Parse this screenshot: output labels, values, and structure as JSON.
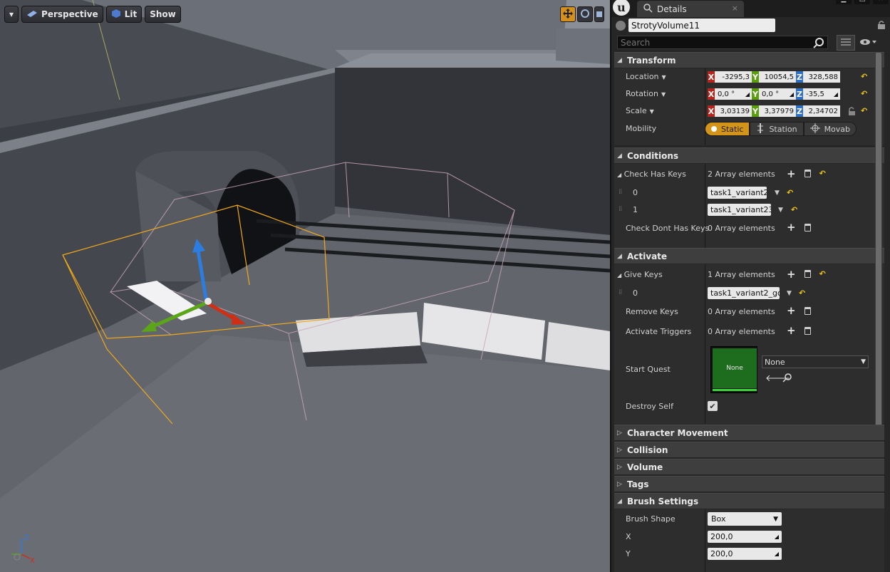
{
  "viewport": {
    "toolbar": {
      "menu_arrow": "▾",
      "perspective_label": "Perspective",
      "lit_label": "Lit",
      "show_label": "Show"
    },
    "axis_labels": {
      "z": "Z",
      "x": "X"
    }
  },
  "details": {
    "tab_label": "Details",
    "tab_close": "×",
    "object_name": "StrotyVolume11",
    "search_placeholder": "Search",
    "transform": {
      "header": "Transform",
      "location_label": "Location",
      "rotation_label": "Rotation",
      "scale_label": "Scale",
      "mobility_label": "Mobility",
      "location": {
        "x": "-3295,3",
        "y": "10054,5",
        "z": "328,588"
      },
      "rotation": {
        "x": "0,0 °",
        "y": "0,0 °",
        "z": "-35,5"
      },
      "scale": {
        "x": "3,03139",
        "y": "3,37979",
        "z": "2,34702"
      },
      "mobility_options": [
        "Static",
        "Station",
        "Movab"
      ],
      "mobility_selected": "Static"
    },
    "conditions": {
      "header": "Conditions",
      "check_has_keys_label": "Check Has Keys",
      "check_has_keys_count": "2 Array elements",
      "check_has_keys_items": [
        {
          "index": "0",
          "value": "task1_variant2"
        },
        {
          "index": "1",
          "value": "task1_variant23"
        }
      ],
      "check_dont_has_keys_label": "Check Dont Has Keys",
      "check_dont_has_keys_count": "0 Array elements"
    },
    "activate": {
      "header": "Activate",
      "give_keys_label": "Give Keys",
      "give_keys_count": "1 Array elements",
      "give_keys_items": [
        {
          "index": "0",
          "value": "task1_variant2_go"
        }
      ],
      "remove_keys_label": "Remove Keys",
      "remove_keys_count": "0 Array elements",
      "activate_triggers_label": "Activate Triggers",
      "activate_triggers_count": "0 Array elements",
      "start_quest_label": "Start Quest",
      "start_quest_thumb": "None",
      "start_quest_value": "None",
      "destroy_self_label": "Destroy Self",
      "destroy_self_checked": true
    },
    "collapsed_sections": [
      "Character Movement",
      "Collision",
      "Volume",
      "Tags"
    ],
    "brush_settings": {
      "header": "Brush Settings",
      "brush_shape_label": "Brush Shape",
      "brush_shape_value": "Box",
      "x_label": "X",
      "x_value": "200,0",
      "y_label": "Y",
      "y_value": "200,0"
    }
  },
  "colors": {
    "accent_orange": "#d39419",
    "axis_x": "#b4251b",
    "axis_y": "#5a9f10",
    "axis_z": "#2d6fc9",
    "reset_yellow": "#e9c21a",
    "quest_green": "#1e6d1e"
  },
  "icons": [
    "unreal-logo-icon",
    "details-icon",
    "lock-icon",
    "search-icon",
    "grid-view-icon",
    "eye-icon",
    "plus-icon",
    "trash-icon",
    "reset-arrow-icon",
    "back-arrow-icon",
    "browse-icon",
    "checkmark-icon"
  ]
}
